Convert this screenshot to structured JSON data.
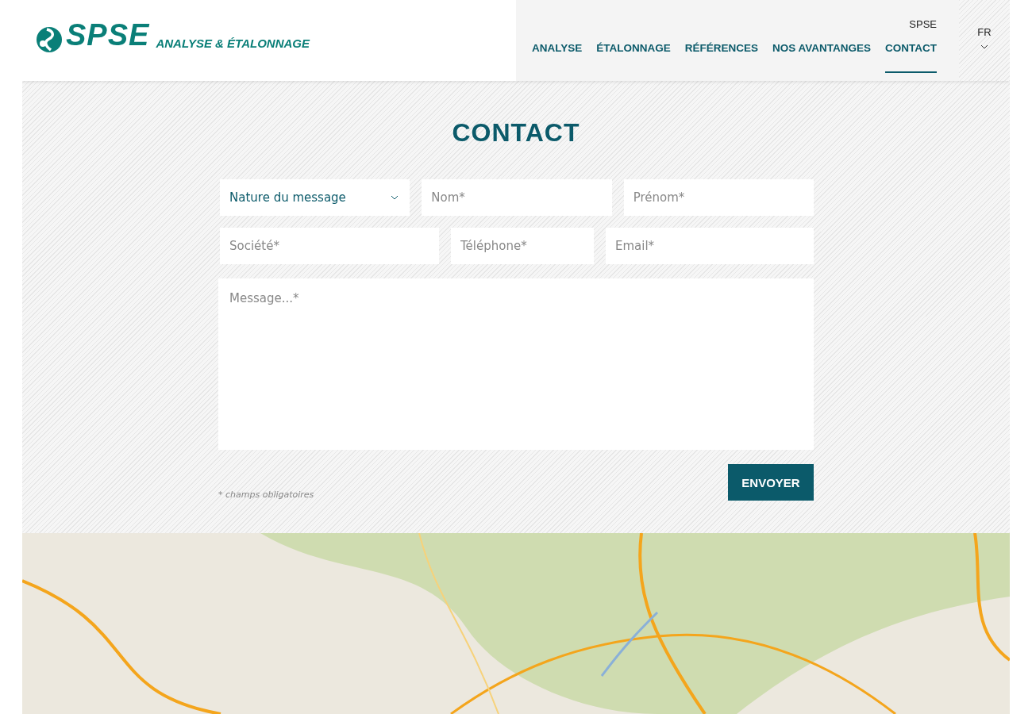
{
  "header": {
    "logo_text": "SPSE",
    "tagline": "ANALYSE & ÉTALONNAGE",
    "top_link": "SPSE",
    "nav": [
      {
        "label": "ANALYSE",
        "selected": false
      },
      {
        "label": "ÉTALONNAGE",
        "selected": false
      },
      {
        "label": "RÉFÉRENCES",
        "selected": false
      },
      {
        "label": "NOS AVANTANGES",
        "selected": false
      },
      {
        "label": "CONTACT",
        "selected": true
      }
    ],
    "language": "FR"
  },
  "contact": {
    "title": "CONTACT",
    "rows": [
      [
        {
          "kind": "select",
          "value": "Nature du message"
        },
        {
          "kind": "input",
          "placeholder": "Nom*"
        },
        {
          "kind": "input",
          "placeholder": "Prénom*"
        }
      ],
      [
        {
          "kind": "input",
          "placeholder": "Société*"
        },
        {
          "kind": "input",
          "placeholder": "Téléphone*"
        },
        {
          "kind": "input",
          "placeholder": "Email*"
        }
      ]
    ],
    "message": {
      "placeholder": "Message...*"
    },
    "required_note": "* champs obligatoires",
    "submit": "ENVOYER"
  }
}
